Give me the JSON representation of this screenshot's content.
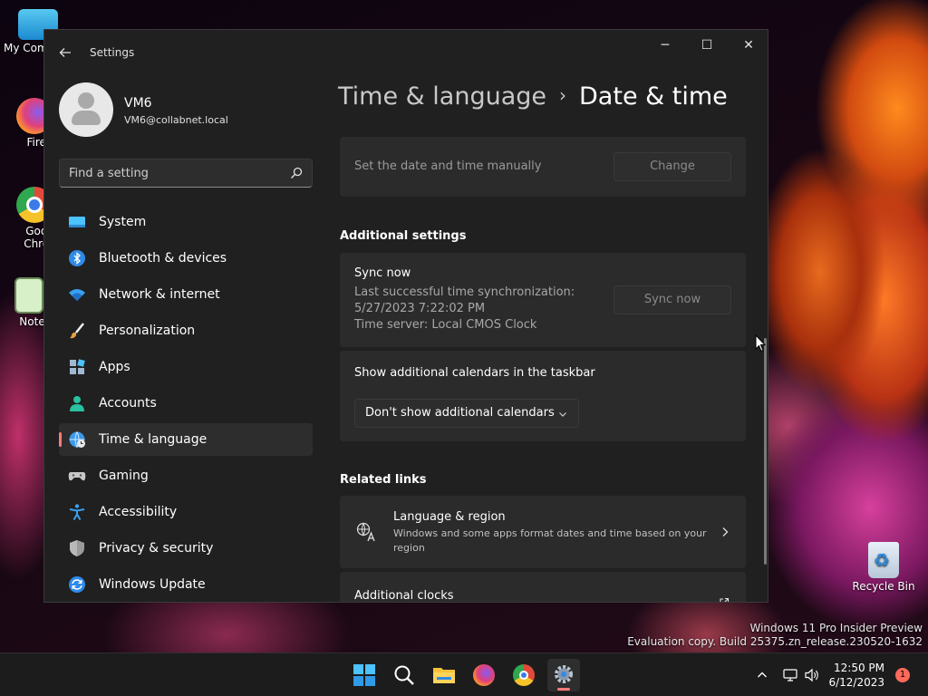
{
  "desktop": {
    "icons": [
      {
        "label": "My Com"
      },
      {
        "label": "Firefo"
      },
      {
        "label": "Goog"
      },
      {
        "label": "Chron"
      },
      {
        "label": "Notepa"
      },
      {
        "label": "Recycle Bin"
      }
    ],
    "watermark": {
      "line1": "Windows 11 Pro Insider Preview",
      "line2": "Evaluation copy. Build 25375.zn_release.230520-1632"
    }
  },
  "window": {
    "app_title": "Settings",
    "back_icon": "back-arrow-icon",
    "controls": {
      "minimize": "─",
      "maximize": "☐",
      "close": "✕"
    }
  },
  "profile": {
    "name": "VM6",
    "email": "VM6@collabnet.local"
  },
  "search": {
    "placeholder": "Find a setting"
  },
  "nav": {
    "items": [
      {
        "label": "System",
        "icon": "system-icon"
      },
      {
        "label": "Bluetooth & devices",
        "icon": "bluetooth-icon"
      },
      {
        "label": "Network & internet",
        "icon": "wifi-icon"
      },
      {
        "label": "Personalization",
        "icon": "brush-icon"
      },
      {
        "label": "Apps",
        "icon": "apps-icon"
      },
      {
        "label": "Accounts",
        "icon": "person-icon"
      },
      {
        "label": "Time & language",
        "icon": "globe-clock-icon",
        "active": true
      },
      {
        "label": "Gaming",
        "icon": "gamepad-icon"
      },
      {
        "label": "Accessibility",
        "icon": "accessibility-icon"
      },
      {
        "label": "Privacy & security",
        "icon": "shield-icon"
      },
      {
        "label": "Windows Update",
        "icon": "update-icon"
      }
    ]
  },
  "breadcrumb": {
    "parent": "Time & language",
    "separator": "›",
    "current": "Date & time"
  },
  "content": {
    "manual": {
      "label": "Set the date and time manually",
      "button": "Change"
    },
    "additional_settings": {
      "heading": "Additional settings",
      "sync": {
        "title": "Sync now",
        "line1": "Last successful time synchronization:",
        "line2": "5/27/2023 7:22:02 PM",
        "line3": "Time server: Local CMOS Clock",
        "button": "Sync now"
      },
      "calendars": {
        "title": "Show additional calendars in the taskbar",
        "selected": "Don't show additional calendars"
      }
    },
    "related_links": {
      "heading": "Related links",
      "language_region": {
        "title": "Language & region",
        "desc_line1": "Windows and some apps format dates and time based on your",
        "desc_line2": "region"
      },
      "additional_clocks": {
        "title": "Additional clocks"
      }
    }
  },
  "taskbar": {
    "time": "12:50 PM",
    "date": "6/12/2023",
    "notification_count": "1"
  },
  "colors": {
    "accent": "#ff7a7a",
    "window_bg": "#202020",
    "card_bg": "#2b2b2b"
  }
}
